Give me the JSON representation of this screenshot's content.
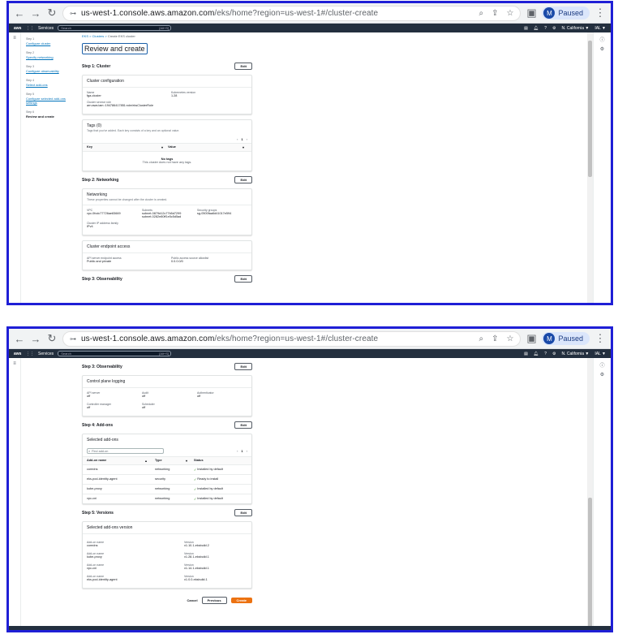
{
  "browser": {
    "url_host": "us-west-1.console.aws.amazon.com",
    "url_path": "/eks/home?region=us-west-1#/cluster-create",
    "profile_initial": "M",
    "profile_status": "Paused"
  },
  "aws": {
    "logo": "aws",
    "services": "Services",
    "search_placeholder": "Search",
    "search_shortcut": "[Alt+S]",
    "region": "N. California ▼",
    "account": "IAL ▼"
  },
  "breadcrumb": {
    "items": [
      "EKS",
      "Clusters",
      "Create EKS cluster"
    ]
  },
  "steps": [
    {
      "label": "Step 1",
      "name": "Configure cluster"
    },
    {
      "label": "Step 2",
      "name": "Specify networking"
    },
    {
      "label": "Step 3",
      "name": "Configure observability"
    },
    {
      "label": "Step 4",
      "name": "Select add-ons"
    },
    {
      "label": "Step 5",
      "name": "Configure selected add-ons settings"
    },
    {
      "label": "Step 6",
      "name": "Review and create"
    }
  ],
  "page_title": "Review and create",
  "edit": "Edit",
  "step1": {
    "title": "Step 1: Cluster",
    "config_title": "Cluster configuration",
    "name_k": "Name",
    "name_v": "fga-cluster",
    "kver_k": "Kubernetes version",
    "kver_v": "1.28",
    "role_k": "Cluster service role",
    "role_v": "arn:aws:iam::194786417851:role/eksClusterRole",
    "tags_title": "Tags (0)",
    "tags_sub": "Tags that you've added. Each key consists of a key and an optional value.",
    "page": "1",
    "key_col": "Key",
    "value_col": "Value",
    "no_tags": "No tags",
    "no_tags_sub": "This cluster does not have any tags."
  },
  "step2": {
    "title": "Step 2: Networking",
    "net_title": "Networking",
    "net_sub": "These properties cannot be changed after the cluster is created.",
    "vpc_k": "VPC",
    "vpc_v": "vpc-0fcdc77726ae83669",
    "subnets_k": "Subnets",
    "subnet1": "subnet-0879d12c77b5d7299",
    "subnet2": "subnet-0282e80ff1e5c5d5ad",
    "sg_k": "Security groups",
    "sg_v": "sg-0500faa6d41017e594",
    "family_k": "Cluster IP address family",
    "family_v": "IPv4",
    "endpoint_title": "Cluster endpoint access",
    "api_k": "API server endpoint access",
    "api_v": "Public and private",
    "pub_k": "Public access source allowlist",
    "pub_v": "0.0.0.0/0"
  },
  "step3": {
    "title": "Step 3: Observability",
    "cp_title": "Control plane logging",
    "api_k": "API server",
    "api_v": "off",
    "audit_k": "Audit",
    "audit_v": "off",
    "auth_k": "Authenticator",
    "auth_v": "off",
    "cm_k": "Controller manager",
    "cm_v": "off",
    "sched_k": "Scheduler",
    "sched_v": "off"
  },
  "step4": {
    "title": "Step 4: Add-ons",
    "sel_title": "Selected add-ons",
    "find": "Find add-on",
    "page": "1",
    "col_name": "Add-on name",
    "col_type": "Type",
    "col_status": "Status",
    "rows": [
      {
        "name": "coredns",
        "type": "networking",
        "status": "Installed by default"
      },
      {
        "name": "eks-pod-identity-agent",
        "type": "security",
        "status": "Ready to install"
      },
      {
        "name": "kube-proxy",
        "type": "networking",
        "status": "Installed by default"
      },
      {
        "name": "vpc-cni",
        "type": "networking",
        "status": "Installed by default"
      }
    ]
  },
  "step5": {
    "title": "Step 5: Versions",
    "ver_title": "Selected add-ons version",
    "addon_k": "Add-on name",
    "ver_k": "Version",
    "rows": [
      {
        "name": "coredns",
        "version": "v1.10.1-eksbuild.2"
      },
      {
        "name": "kube-proxy",
        "version": "v1.28.1-eksbuild.1"
      },
      {
        "name": "vpc-cni",
        "version": "v1.14.1-eksbuild.1"
      },
      {
        "name": "eks-pod-identity-agent",
        "version": "v1.0.0-eksbuild.1"
      }
    ]
  },
  "footer": {
    "cancel": "Cancel",
    "previous": "Previous",
    "create": "Create"
  }
}
